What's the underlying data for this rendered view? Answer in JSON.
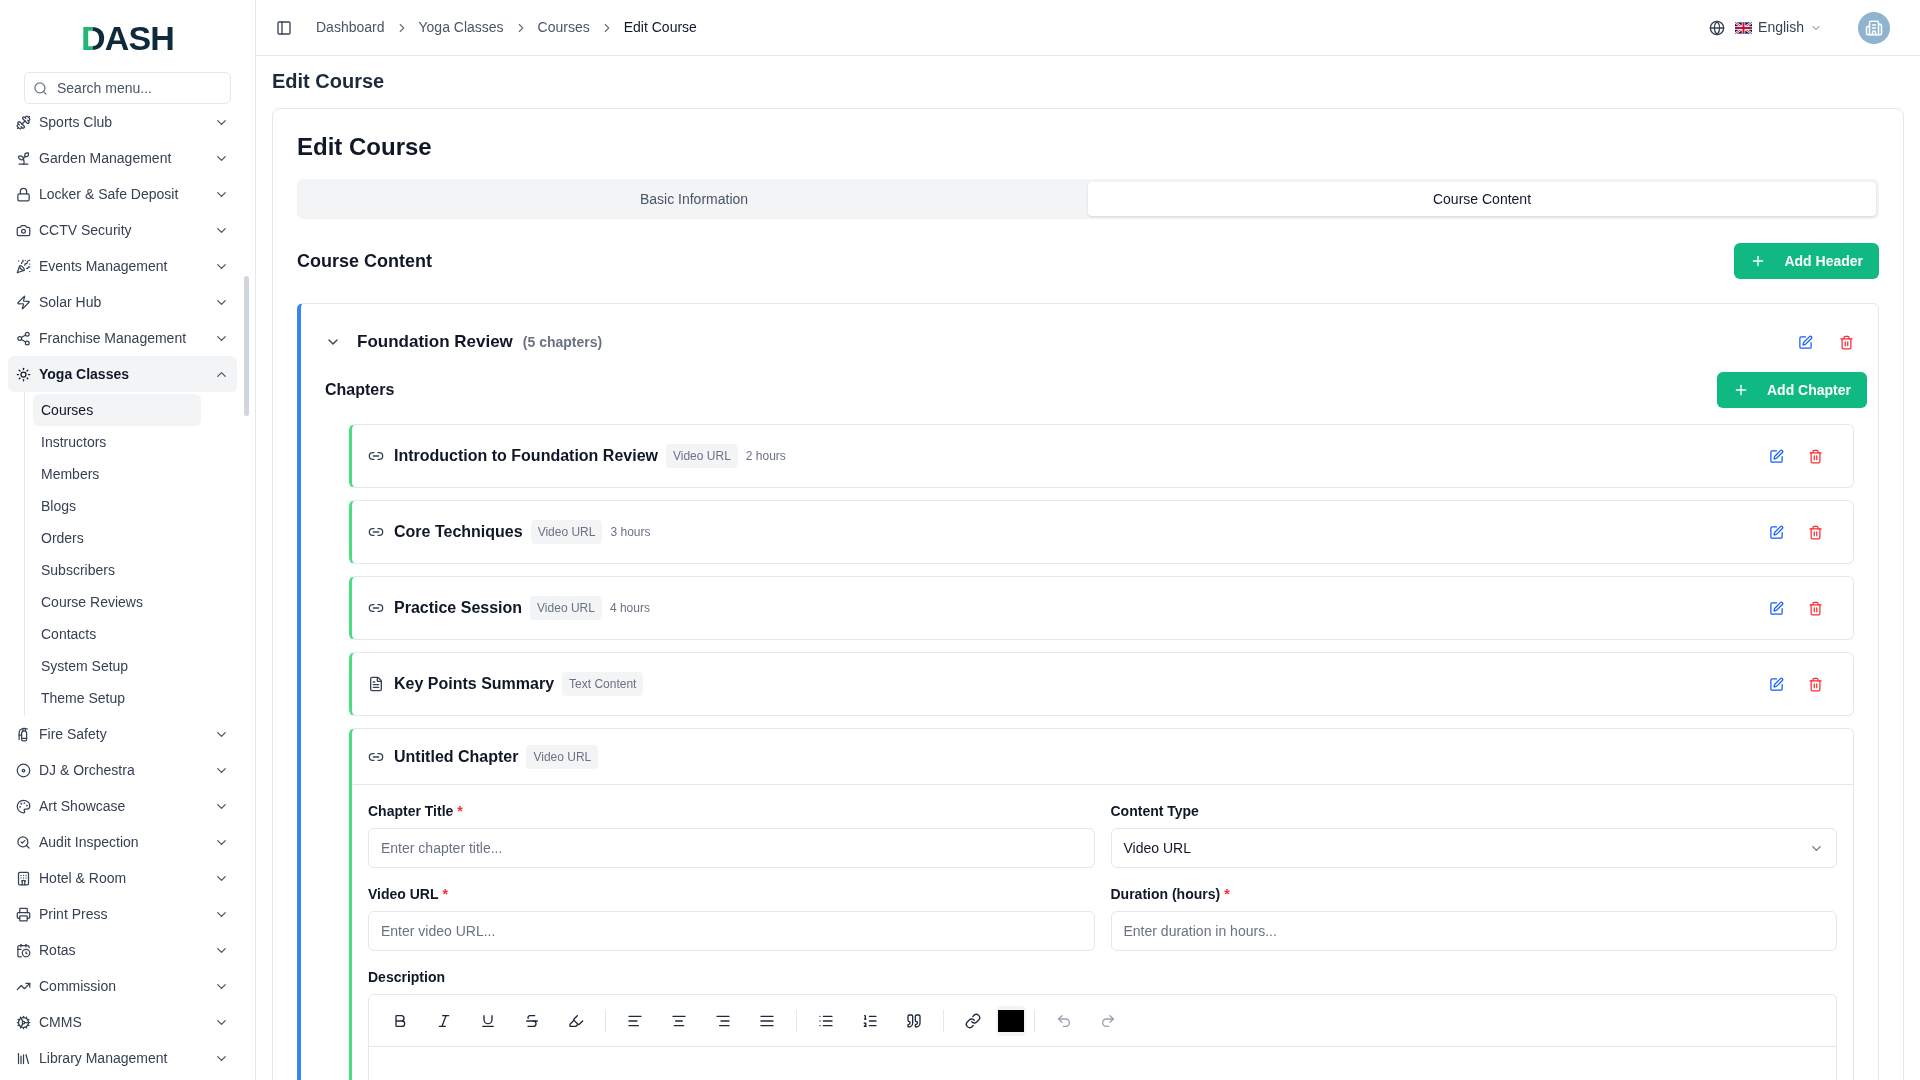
{
  "sidebar": {
    "logo": "DASH",
    "search": {
      "placeholder": "Search menu..."
    },
    "items": [
      {
        "label": "Sports Club",
        "expanded": false,
        "selected": false
      },
      {
        "label": "Garden Management",
        "expanded": false,
        "selected": false
      },
      {
        "label": "Locker & Safe Deposit",
        "expanded": false,
        "selected": false
      },
      {
        "label": "CCTV Security",
        "expanded": false,
        "selected": false
      },
      {
        "label": "Events Management",
        "expanded": false,
        "selected": false
      },
      {
        "label": "Solar Hub",
        "expanded": false,
        "selected": false
      },
      {
        "label": "Franchise Management",
        "expanded": false,
        "selected": false
      },
      {
        "label": "Yoga Classes",
        "expanded": true,
        "selected": true,
        "children": [
          {
            "label": "Courses",
            "selected": true
          },
          {
            "label": "Instructors",
            "selected": false
          },
          {
            "label": "Members",
            "selected": false
          },
          {
            "label": "Blogs",
            "selected": false
          },
          {
            "label": "Orders",
            "selected": false
          },
          {
            "label": "Subscribers",
            "selected": false
          },
          {
            "label": "Course Reviews",
            "selected": false
          },
          {
            "label": "Contacts",
            "selected": false
          },
          {
            "label": "System Setup",
            "selected": false
          },
          {
            "label": "Theme Setup",
            "selected": false
          }
        ]
      },
      {
        "label": "Fire Safety",
        "expanded": false,
        "selected": false
      },
      {
        "label": "DJ & Orchestra",
        "expanded": false,
        "selected": false
      },
      {
        "label": "Art Showcase",
        "expanded": false,
        "selected": false
      },
      {
        "label": "Audit Inspection",
        "expanded": false,
        "selected": false
      },
      {
        "label": "Hotel & Room",
        "expanded": false,
        "selected": false
      },
      {
        "label": "Print Press",
        "expanded": false,
        "selected": false
      },
      {
        "label": "Rotas",
        "expanded": false,
        "selected": false
      },
      {
        "label": "Commission",
        "expanded": false,
        "selected": false
      },
      {
        "label": "CMMS",
        "expanded": false,
        "selected": false
      },
      {
        "label": "Library Management",
        "expanded": false,
        "selected": false
      }
    ]
  },
  "header": {
    "breadcrumbs": [
      "Dashboard",
      "Yoga Classes",
      "Courses",
      "Edit Course"
    ],
    "language": "English"
  },
  "page_title": "Edit Course",
  "card": {
    "title": "Edit Course",
    "tabs": [
      {
        "label": "Basic Information",
        "selected": false
      },
      {
        "label": "Course Content",
        "selected": true
      }
    ],
    "section_title": "Course Content",
    "add_header_button": "Add Header",
    "headers": [
      {
        "title": "Foundation Review",
        "count": "(5 chapters)",
        "expanded": true,
        "chapters_title": "Chapters",
        "add_chapter_button": "Add Chapter",
        "chapters": [
          {
            "kind": "video",
            "title": "Introduction to Foundation Review",
            "badge": "Video URL",
            "duration": "2 hours",
            "expanded": false
          },
          {
            "kind": "video",
            "title": "Core Techniques",
            "badge": "Video URL",
            "duration": "3 hours",
            "expanded": false
          },
          {
            "kind": "video",
            "title": "Practice Session",
            "badge": "Video URL",
            "duration": "4 hours",
            "expanded": false
          },
          {
            "kind": "text",
            "title": "Key Points Summary",
            "badge": "Text Content",
            "expanded": false
          },
          {
            "kind": "video",
            "title": "Untitled Chapter",
            "badge": "Video URL",
            "expanded": true,
            "form": {
              "fields": [
                {
                  "kind": "input",
                  "label": "Chapter Title",
                  "required_mark": "*",
                  "placeholder": "Enter chapter title..."
                },
                {
                  "kind": "select",
                  "label": "Content Type",
                  "value": "Video URL"
                },
                {
                  "kind": "input",
                  "label": "Video URL",
                  "required_mark": "*",
                  "placeholder": "Enter video URL..."
                },
                {
                  "kind": "input",
                  "label": "Duration (hours)",
                  "required_mark": "*",
                  "placeholder": "Enter duration in hours..."
                }
              ],
              "description_label": "Description"
            }
          }
        ]
      }
    ]
  }
}
